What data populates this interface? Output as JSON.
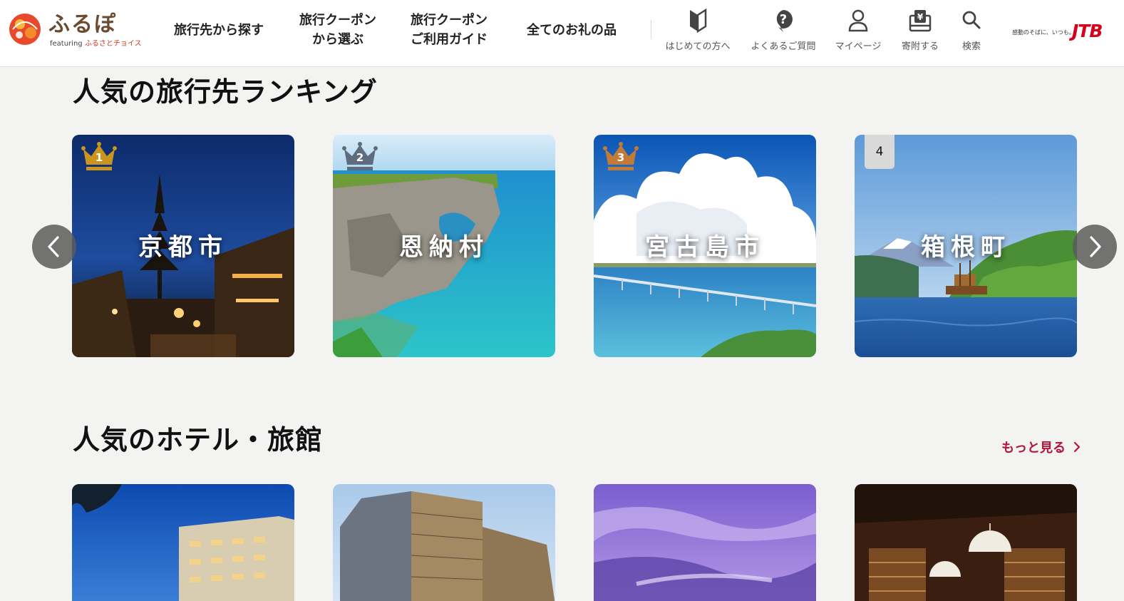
{
  "header": {
    "logo": {
      "text": "ふるぽ",
      "featuring": "featuring",
      "partner": "ふるさとチョイス"
    },
    "nav": [
      {
        "line1": "旅行先から探す",
        "line2": ""
      },
      {
        "line1": "旅行クーポン",
        "line2": "から選ぶ"
      },
      {
        "line1": "旅行クーポン",
        "line2": "ご利用ガイド"
      },
      {
        "line1": "全てのお礼の品",
        "line2": ""
      }
    ],
    "utilities": [
      {
        "label": "はじめての方へ",
        "icon": "beginner-mark-icon"
      },
      {
        "label": "よくあるご質問",
        "icon": "question-icon"
      },
      {
        "label": "マイページ",
        "icon": "user-icon"
      },
      {
        "label": "寄附する",
        "icon": "yen-donate-icon"
      },
      {
        "label": "検索",
        "icon": "search-icon"
      }
    ],
    "jtb": {
      "tagline": "感動のそばに、いつも。",
      "mark": "JTB"
    }
  },
  "ranking": {
    "title": "人気の旅行先ランキング",
    "items": [
      {
        "rank": "1",
        "name": "京都市",
        "badge": "gold"
      },
      {
        "rank": "2",
        "name": "恩納村",
        "badge": "silver"
      },
      {
        "rank": "3",
        "name": "宮古島市",
        "badge": "bronze"
      },
      {
        "rank": "4",
        "name": "箱根町",
        "badge": "plain"
      }
    ],
    "prev_icon": "chevron-left-icon",
    "next_icon": "chevron-right-icon"
  },
  "hotels": {
    "title": "人気のホテル・旅館",
    "more": "もっと見る"
  },
  "colors": {
    "accent": "#b3153c",
    "gold": "#c9951c",
    "silver": "#5e6c7d",
    "bronze": "#c27a35",
    "jtb": "#d6001c"
  }
}
